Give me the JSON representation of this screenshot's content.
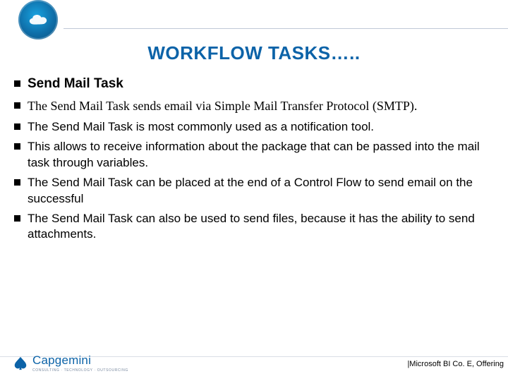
{
  "title": "WORKFLOW TASKS…..",
  "section_heading": "Send Mail Task",
  "bullets": [
    {
      "text": "The Send Mail Task sends email via Simple Mail Transfer Protocol (SMTP).",
      "serif": true
    },
    {
      "text": "The Send Mail Task is most commonly used as a notification tool.",
      "serif": false
    },
    {
      "text": "This allows to receive information about the package that can be passed into the mail task through variables.",
      "serif": false
    },
    {
      "text": "The Send Mail Task can be placed at the end of a Control Flow to send email on the successful",
      "serif": false
    },
    {
      "text": "The Send Mail Task can also be used to send files, because it has the ability to send attachments.",
      "serif": false
    }
  ],
  "footer": {
    "brand": "Capgemini",
    "tagline": "CONSULTING · TECHNOLOGY · OUTSOURCING",
    "right": "|Microsoft BI Co. E, Offering"
  },
  "colors": {
    "accent": "#0c63a8"
  }
}
